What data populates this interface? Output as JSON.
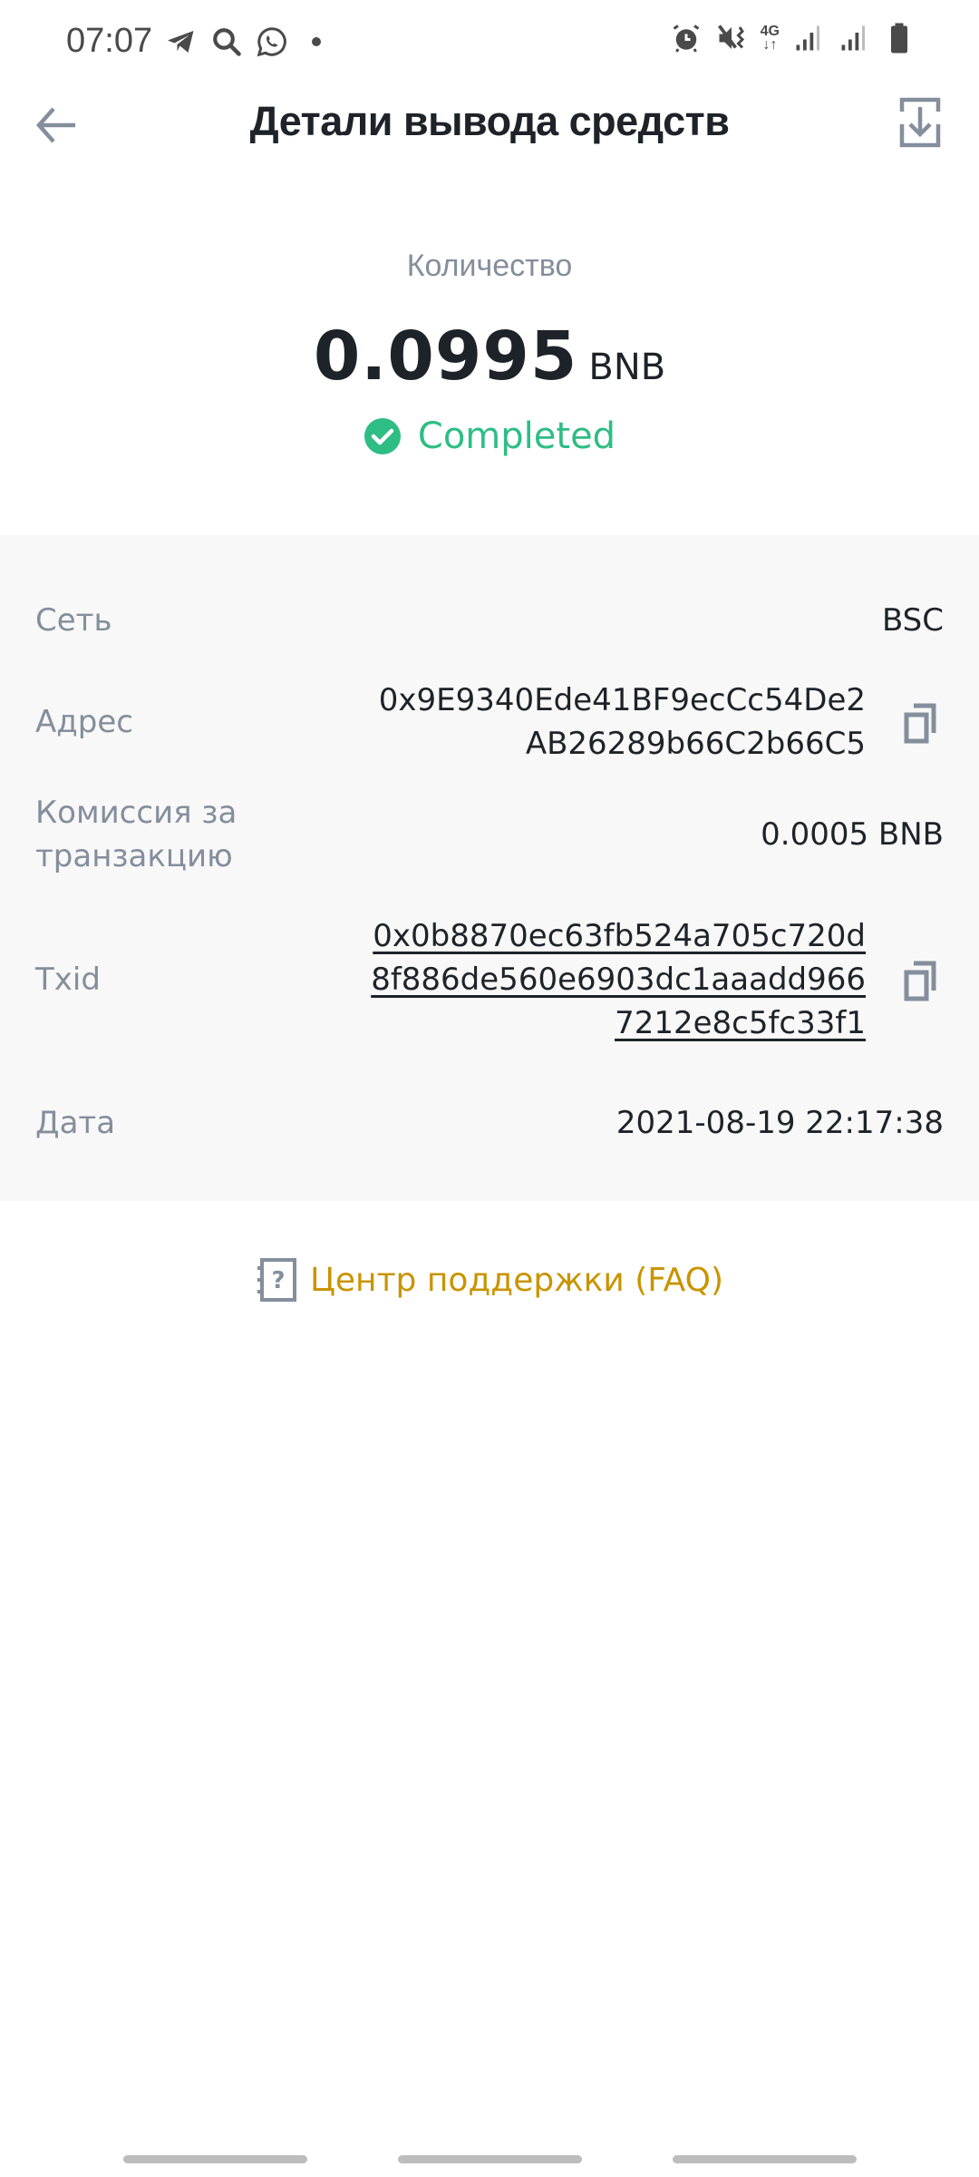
{
  "status_bar": {
    "time": "07:07",
    "left_icons": [
      "telegram-icon",
      "search-icon",
      "whatsapp-icon",
      "notification-dot"
    ],
    "network_label": "4G",
    "right_icons": [
      "alarm-icon",
      "vibrate-mute-icon",
      "network-4g-icon",
      "signal-icon",
      "signal-icon",
      "battery-icon"
    ]
  },
  "header": {
    "title": "Детали вывода средств",
    "back_icon": "arrow-left-icon",
    "download_icon": "download-icon"
  },
  "summary": {
    "amount_label": "Количество",
    "amount_value": "0.0995",
    "amount_unit": "BNB",
    "status": "Completed",
    "status_color": "#2ebd85"
  },
  "details": {
    "rows": [
      {
        "label": "Сеть",
        "value": "BSC"
      },
      {
        "label": "Адрес",
        "value_lines": [
          "0x9E9340Ede41BF9ecCc54De2",
          "AB26289b66C2b66C5"
        ],
        "copyable": true
      },
      {
        "label_lines": [
          "Комиссия за",
          "транзакцию"
        ],
        "value": "0.0005 BNB"
      },
      {
        "label": "Txid",
        "value_lines": [
          "0x0b8870ec63fb524a705c720d",
          "8f886de560e6903dc1aaadd966",
          "7212e8c5fc33f1"
        ],
        "copyable": true,
        "link": true
      },
      {
        "label": "Дата",
        "value": "2021-08-19 22:17:38"
      }
    ]
  },
  "faq": {
    "label": "Центр поддержки (FAQ)",
    "color": "#c99400"
  },
  "colors": {
    "text_primary": "#1e2329",
    "text_secondary": "#848e9c",
    "panel_bg": "#f8f8f8",
    "success": "#2ebd85",
    "accent": "#c99400"
  }
}
